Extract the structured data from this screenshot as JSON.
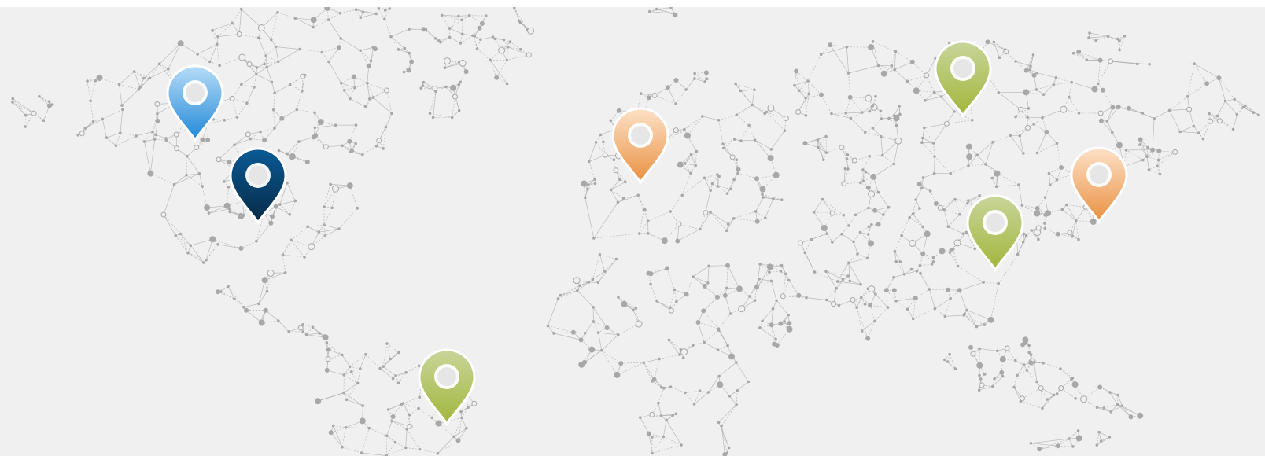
{
  "map": {
    "style": "dotted-network world map",
    "background_color": "#f0f0f0",
    "network_color": "#a8a8a8",
    "continents": [
      "north-america",
      "south-america",
      "europe",
      "africa",
      "asia",
      "southeast-asia"
    ]
  },
  "pins": [
    {
      "id": "pin-north-america-west",
      "color_top": "#b7dcf7",
      "color_bottom": "#1f88d8",
      "style": "light-blue"
    },
    {
      "id": "pin-north-america-central",
      "color_top": "#0a5a96",
      "color_bottom": "#062a45",
      "style": "dark-blue"
    },
    {
      "id": "pin-south-america",
      "color_top": "#c8d59a",
      "color_bottom": "#a2b63c",
      "style": "green"
    },
    {
      "id": "pin-europe",
      "color_top": "#fde1c8",
      "color_bottom": "#e99040",
      "style": "orange"
    },
    {
      "id": "pin-russia",
      "color_top": "#c8d59a",
      "color_bottom": "#a2b63c",
      "style": "green"
    },
    {
      "id": "pin-china",
      "color_top": "#c8d59a",
      "color_bottom": "#a2b63c",
      "style": "green"
    },
    {
      "id": "pin-japan",
      "color_top": "#fde1c8",
      "color_bottom": "#e99040",
      "style": "orange"
    }
  ]
}
